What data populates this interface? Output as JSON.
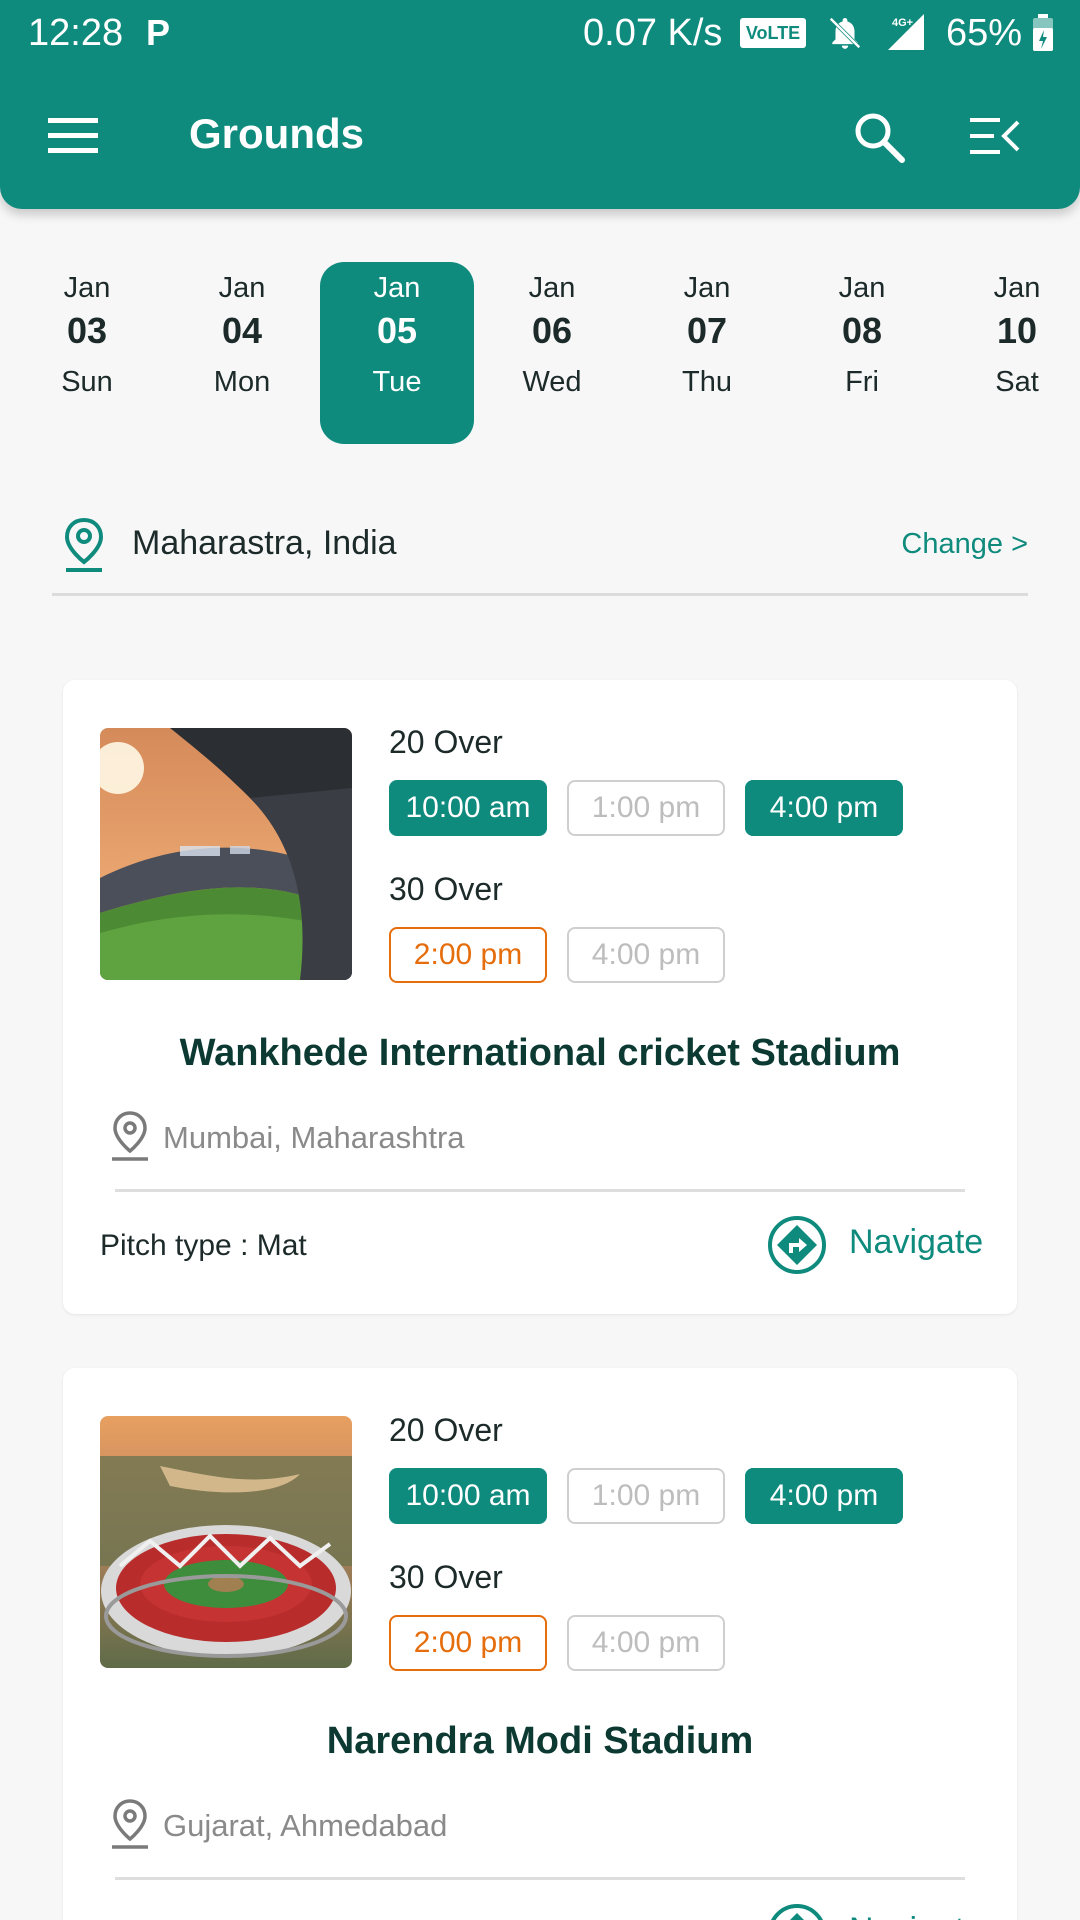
{
  "status_bar": {
    "time": "12:28",
    "app_icon": "P",
    "net_speed": "0.07 K/s",
    "volte": "VoLTE",
    "network": "4G+",
    "battery": "65%"
  },
  "header": {
    "title": "Grounds",
    "icons": [
      "menu-icon",
      "search-icon",
      "filter-menu-icon"
    ]
  },
  "dates": [
    {
      "month": "Jan",
      "day": "03",
      "weekday": "Sun"
    },
    {
      "month": "Jan",
      "day": "04",
      "weekday": "Mon"
    },
    {
      "month": "Jan",
      "day": "05",
      "weekday": "Tue"
    },
    {
      "month": "Jan",
      "day": "06",
      "weekday": "Wed"
    },
    {
      "month": "Jan",
      "day": "07",
      "weekday": "Thu"
    },
    {
      "month": "Jan",
      "day": "08",
      "weekday": "Fri"
    },
    {
      "month": "Jan",
      "day": "10",
      "weekday": "Sat"
    }
  ],
  "selected_date_index": 2,
  "location": {
    "text": "Maharastra, India",
    "change_label": "Change >"
  },
  "grounds": [
    {
      "name": "Wankhede International cricket Stadium",
      "city": "Mumbai, Maharashtra",
      "pitch": "Pitch type : Mat",
      "navigate_label": "Navigate",
      "overs": [
        {
          "label": "20 Over",
          "slots": [
            {
              "time": "10:00 am",
              "state": "booked"
            },
            {
              "time": "1:00 pm",
              "state": "unavailable"
            },
            {
              "time": "4:00 pm",
              "state": "booked"
            }
          ]
        },
        {
          "label": "30 Over",
          "slots": [
            {
              "time": "2:00 pm",
              "state": "selected"
            },
            {
              "time": "4:00 pm",
              "state": "unavailable"
            }
          ]
        }
      ]
    },
    {
      "name": "Narendra Modi Stadium",
      "city": "Gujarat, Ahmedabad",
      "pitch": "",
      "navigate_label": "Navigate",
      "overs": [
        {
          "label": "20 Over",
          "slots": [
            {
              "time": "10:00 am",
              "state": "booked"
            },
            {
              "time": "1:00 pm",
              "state": "unavailable"
            },
            {
              "time": "4:00 pm",
              "state": "booked"
            }
          ]
        },
        {
          "label": "30 Over",
          "slots": [
            {
              "time": "2:00 pm",
              "state": "selected"
            },
            {
              "time": "4:00 pm",
              "state": "unavailable"
            }
          ]
        }
      ]
    }
  ],
  "colors": {
    "primary": "#0f8b7e",
    "accent_orange": "#e56d0c",
    "unavailable": "#bdbdbd"
  }
}
